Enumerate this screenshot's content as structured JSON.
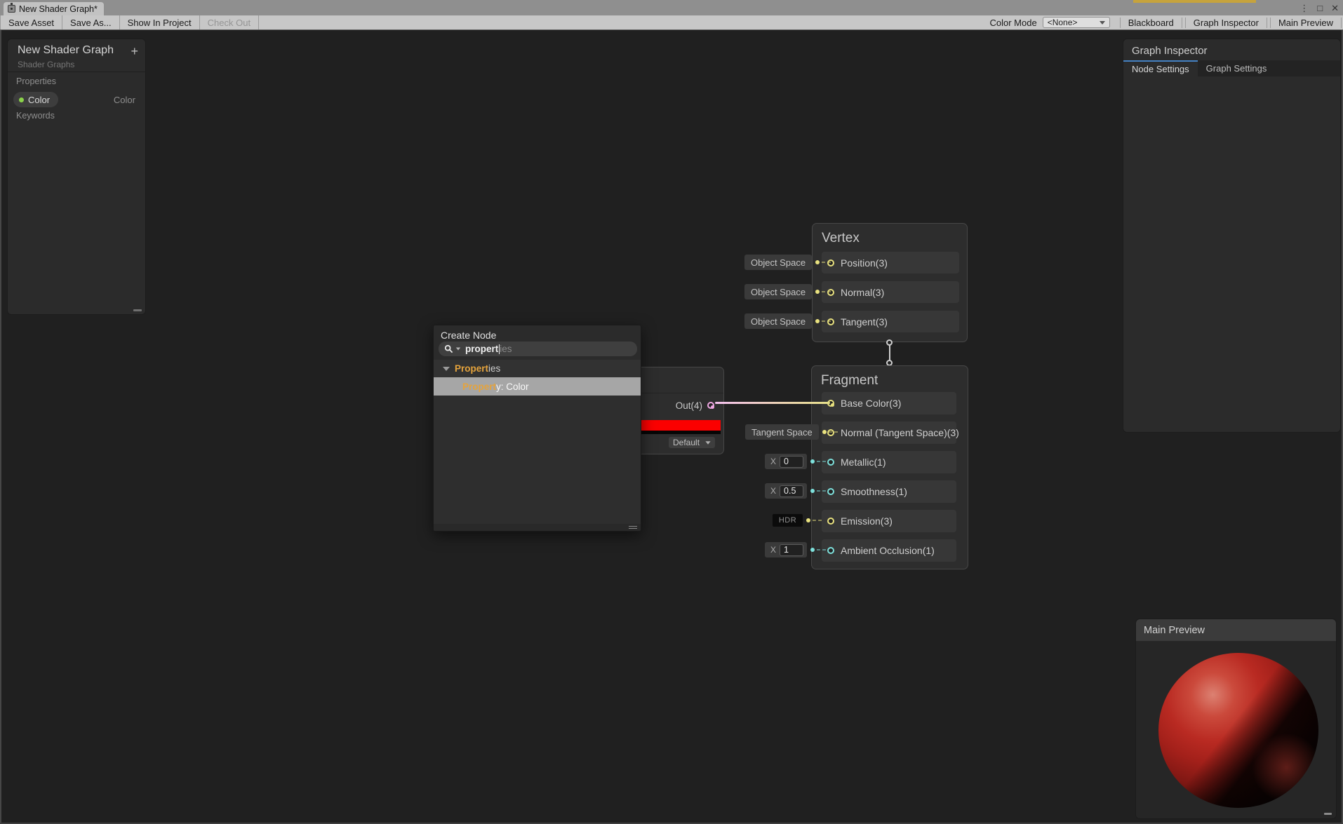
{
  "colors": {
    "accent-blue": "#4481C3",
    "port-vec3": "#E9E27F",
    "port-vec1": "#7EE1DC",
    "port-vec4": "#F0A8E4",
    "edge-from": "#F4C1EE",
    "edge-to": "#E6E089",
    "prop-green": "#8BD34A",
    "swatch-red": "#FB0000",
    "match-yellow": "#E5A33C",
    "gold": "#C6A33D"
  },
  "window": {
    "tab_title": "New Shader Graph*",
    "controls": {
      "menu": "⋮",
      "maximize": "□",
      "close": "✕"
    }
  },
  "toolbar": {
    "buttons": [
      {
        "label": "Save Asset"
      },
      {
        "label": "Save As..."
      },
      {
        "label": "Show In Project"
      },
      {
        "label": "Check Out"
      }
    ],
    "color_mode_label": "Color Mode",
    "color_mode_value": "<None>",
    "right_buttons": [
      {
        "label": "Blackboard"
      },
      {
        "label": "Graph Inspector"
      },
      {
        "label": "Main Preview"
      }
    ]
  },
  "blackboard": {
    "title": "New Shader Graph",
    "subtitle": "Shader Graphs",
    "add_label": "+",
    "properties_label": "Properties",
    "keywords_label": "Keywords",
    "property": {
      "name": "Color",
      "type": "Color"
    }
  },
  "inspector": {
    "title": "Graph Inspector",
    "tabs": [
      {
        "label": "Node Settings"
      },
      {
        "label": "Graph Settings"
      }
    ]
  },
  "create_node": {
    "title": "Create Node",
    "search_typed": "propert",
    "search_ghost": "ies",
    "group": {
      "match": "Propert",
      "rest": "ies"
    },
    "result": {
      "match": "Propert",
      "rest": "y: Color"
    }
  },
  "color_node": {
    "out_label": "Out(4)",
    "mode_value": "Default"
  },
  "vertex_node": {
    "title": "Vertex",
    "slots": [
      {
        "label": "Position(3)",
        "tag": "Object Space"
      },
      {
        "label": "Normal(3)",
        "tag": "Object Space"
      },
      {
        "label": "Tangent(3)",
        "tag": "Object Space"
      }
    ]
  },
  "fragment_node": {
    "title": "Fragment",
    "slots": [
      {
        "label": "Base Color(3)"
      },
      {
        "label": "Normal (Tangent Space)(3)",
        "widget": {
          "text": "Tangent Space"
        }
      },
      {
        "label": "Metallic(1)",
        "widget": {
          "label": "X",
          "value": "0"
        }
      },
      {
        "label": "Smoothness(1)",
        "widget": {
          "label": "X",
          "value": "0.5"
        }
      },
      {
        "label": "Emission(3)",
        "widget": {
          "text": "HDR"
        }
      },
      {
        "label": "Ambient Occlusion(1)",
        "widget": {
          "label": "X",
          "value": "1"
        }
      }
    ]
  },
  "preview": {
    "title": "Main Preview"
  }
}
